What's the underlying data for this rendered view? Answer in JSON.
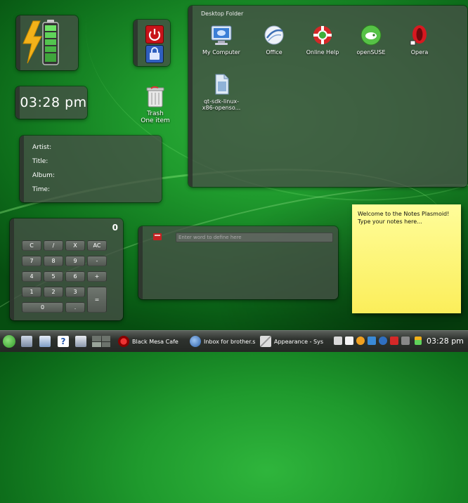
{
  "clock": {
    "time": "03:28 pm"
  },
  "trash": {
    "label": "Trash",
    "status": "One item"
  },
  "now_playing": {
    "artist_label": "Artist:",
    "title_label": "Title:",
    "album_label": "Album:",
    "time_label": "Time:"
  },
  "folder_view": {
    "title": "Desktop Folder",
    "items": [
      {
        "label": "My Computer",
        "icon": "computer-icon"
      },
      {
        "label": "Office",
        "icon": "office-icon"
      },
      {
        "label": "Online Help",
        "icon": "help-lifebuoy-icon"
      },
      {
        "label": "openSUSE",
        "icon": "opensuse-icon"
      },
      {
        "label": "Opera",
        "icon": "opera-icon"
      },
      {
        "label": "qt-sdk-linux-x86-openso...",
        "icon": "file-icon"
      }
    ]
  },
  "calculator": {
    "display": "0",
    "keys": [
      "C",
      "/",
      "X",
      "AC",
      "7",
      "8",
      "9",
      "-",
      "4",
      "5",
      "6",
      "+",
      "1",
      "2",
      "3",
      "=",
      "0",
      "."
    ]
  },
  "dictionary": {
    "placeholder": "Enter word to define here"
  },
  "notes": {
    "line1": "Welcome to the Notes Plasmoid!",
    "line2": "Type your notes here..."
  },
  "taskbar": {
    "tasks": [
      {
        "label": "Black Mesa Cafe",
        "icon": "browser-icon"
      },
      {
        "label": "Inbox for brother.s",
        "icon": "mail-icon"
      },
      {
        "label": "Appearance - Sys",
        "icon": "tools-icon"
      }
    ],
    "clock": "03:28 pm"
  },
  "colors": {
    "accent_green": "#1f9a2d",
    "note_yellow": "#fbee5a",
    "battery_green": "#5fd35a"
  }
}
